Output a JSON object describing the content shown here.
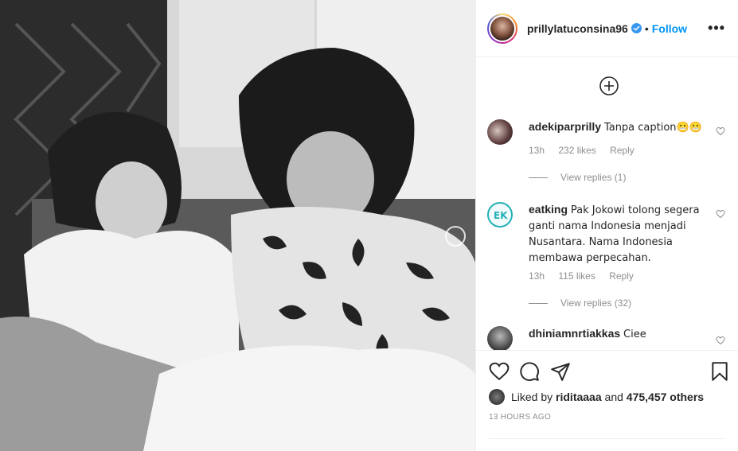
{
  "post": {
    "username": "prillylatuconsina96",
    "follow_label": "Follow",
    "more_label": "•••"
  },
  "comments": [
    {
      "username": "adekiparprilly",
      "text": "Tanpa caption😬😬",
      "time": "13h",
      "likes": "232 likes",
      "reply": "Reply",
      "view_replies": "View replies (1)"
    },
    {
      "username": "eatking",
      "text": "Pak Jokowi tolong segera ganti nama Indonesia menjadi Nusantara. Nama Indonesia membawa perpecahan.",
      "time": "13h",
      "likes": "115 likes",
      "reply": "Reply",
      "view_replies": "View replies (32)"
    },
    {
      "username": "dhiniamnrtiakkas",
      "text": "Ciee"
    }
  ],
  "footer": {
    "liked_prefix": "Liked by",
    "liked_user": "riditaaaa",
    "liked_and": "and",
    "liked_count": "475,457 others",
    "timestamp": "13 HOURS AGO"
  }
}
